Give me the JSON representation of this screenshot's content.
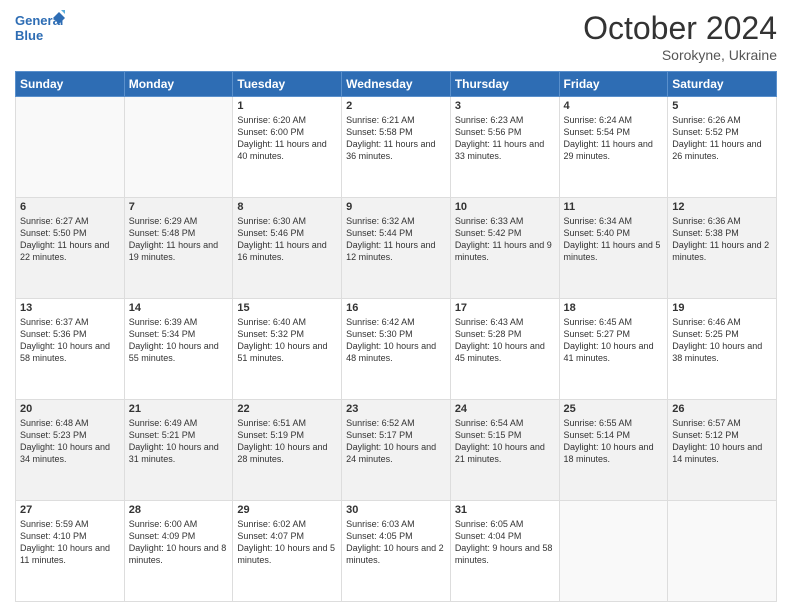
{
  "header": {
    "logo_line1": "General",
    "logo_line2": "Blue",
    "month": "October 2024",
    "location": "Sorokyne, Ukraine"
  },
  "weekdays": [
    "Sunday",
    "Monday",
    "Tuesday",
    "Wednesday",
    "Thursday",
    "Friday",
    "Saturday"
  ],
  "weeks": [
    [
      {
        "day": "",
        "info": ""
      },
      {
        "day": "",
        "info": ""
      },
      {
        "day": "1",
        "info": "Sunrise: 6:20 AM\nSunset: 6:00 PM\nDaylight: 11 hours and 40 minutes."
      },
      {
        "day": "2",
        "info": "Sunrise: 6:21 AM\nSunset: 5:58 PM\nDaylight: 11 hours and 36 minutes."
      },
      {
        "day": "3",
        "info": "Sunrise: 6:23 AM\nSunset: 5:56 PM\nDaylight: 11 hours and 33 minutes."
      },
      {
        "day": "4",
        "info": "Sunrise: 6:24 AM\nSunset: 5:54 PM\nDaylight: 11 hours and 29 minutes."
      },
      {
        "day": "5",
        "info": "Sunrise: 6:26 AM\nSunset: 5:52 PM\nDaylight: 11 hours and 26 minutes."
      }
    ],
    [
      {
        "day": "6",
        "info": "Sunrise: 6:27 AM\nSunset: 5:50 PM\nDaylight: 11 hours and 22 minutes."
      },
      {
        "day": "7",
        "info": "Sunrise: 6:29 AM\nSunset: 5:48 PM\nDaylight: 11 hours and 19 minutes."
      },
      {
        "day": "8",
        "info": "Sunrise: 6:30 AM\nSunset: 5:46 PM\nDaylight: 11 hours and 16 minutes."
      },
      {
        "day": "9",
        "info": "Sunrise: 6:32 AM\nSunset: 5:44 PM\nDaylight: 11 hours and 12 minutes."
      },
      {
        "day": "10",
        "info": "Sunrise: 6:33 AM\nSunset: 5:42 PM\nDaylight: 11 hours and 9 minutes."
      },
      {
        "day": "11",
        "info": "Sunrise: 6:34 AM\nSunset: 5:40 PM\nDaylight: 11 hours and 5 minutes."
      },
      {
        "day": "12",
        "info": "Sunrise: 6:36 AM\nSunset: 5:38 PM\nDaylight: 11 hours and 2 minutes."
      }
    ],
    [
      {
        "day": "13",
        "info": "Sunrise: 6:37 AM\nSunset: 5:36 PM\nDaylight: 10 hours and 58 minutes."
      },
      {
        "day": "14",
        "info": "Sunrise: 6:39 AM\nSunset: 5:34 PM\nDaylight: 10 hours and 55 minutes."
      },
      {
        "day": "15",
        "info": "Sunrise: 6:40 AM\nSunset: 5:32 PM\nDaylight: 10 hours and 51 minutes."
      },
      {
        "day": "16",
        "info": "Sunrise: 6:42 AM\nSunset: 5:30 PM\nDaylight: 10 hours and 48 minutes."
      },
      {
        "day": "17",
        "info": "Sunrise: 6:43 AM\nSunset: 5:28 PM\nDaylight: 10 hours and 45 minutes."
      },
      {
        "day": "18",
        "info": "Sunrise: 6:45 AM\nSunset: 5:27 PM\nDaylight: 10 hours and 41 minutes."
      },
      {
        "day": "19",
        "info": "Sunrise: 6:46 AM\nSunset: 5:25 PM\nDaylight: 10 hours and 38 minutes."
      }
    ],
    [
      {
        "day": "20",
        "info": "Sunrise: 6:48 AM\nSunset: 5:23 PM\nDaylight: 10 hours and 34 minutes."
      },
      {
        "day": "21",
        "info": "Sunrise: 6:49 AM\nSunset: 5:21 PM\nDaylight: 10 hours and 31 minutes."
      },
      {
        "day": "22",
        "info": "Sunrise: 6:51 AM\nSunset: 5:19 PM\nDaylight: 10 hours and 28 minutes."
      },
      {
        "day": "23",
        "info": "Sunrise: 6:52 AM\nSunset: 5:17 PM\nDaylight: 10 hours and 24 minutes."
      },
      {
        "day": "24",
        "info": "Sunrise: 6:54 AM\nSunset: 5:15 PM\nDaylight: 10 hours and 21 minutes."
      },
      {
        "day": "25",
        "info": "Sunrise: 6:55 AM\nSunset: 5:14 PM\nDaylight: 10 hours and 18 minutes."
      },
      {
        "day": "26",
        "info": "Sunrise: 6:57 AM\nSunset: 5:12 PM\nDaylight: 10 hours and 14 minutes."
      }
    ],
    [
      {
        "day": "27",
        "info": "Sunrise: 5:59 AM\nSunset: 4:10 PM\nDaylight: 10 hours and 11 minutes."
      },
      {
        "day": "28",
        "info": "Sunrise: 6:00 AM\nSunset: 4:09 PM\nDaylight: 10 hours and 8 minutes."
      },
      {
        "day": "29",
        "info": "Sunrise: 6:02 AM\nSunset: 4:07 PM\nDaylight: 10 hours and 5 minutes."
      },
      {
        "day": "30",
        "info": "Sunrise: 6:03 AM\nSunset: 4:05 PM\nDaylight: 10 hours and 2 minutes."
      },
      {
        "day": "31",
        "info": "Sunrise: 6:05 AM\nSunset: 4:04 PM\nDaylight: 9 hours and 58 minutes."
      },
      {
        "day": "",
        "info": ""
      },
      {
        "day": "",
        "info": ""
      }
    ]
  ]
}
